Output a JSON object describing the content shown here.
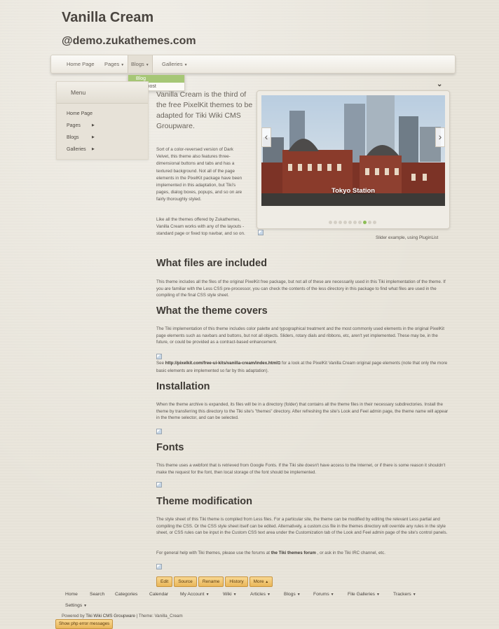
{
  "header": {
    "site_title": "Vanilla Cream",
    "site_subtitle": "@demo.zukathemes.com"
  },
  "navbar": {
    "items": [
      {
        "label": "Home Page"
      },
      {
        "label": "Pages"
      },
      {
        "label": "Blogs"
      },
      {
        "label": "Galleries"
      }
    ],
    "dropdown": [
      "Blog",
      "First post"
    ]
  },
  "sidebar": {
    "title": "Menu",
    "items": [
      "Home Page",
      "Pages",
      "Blogs",
      "Galleries"
    ]
  },
  "intro": {
    "lead": "Vanilla Cream is the third of the free PixelKit themes to be adapted for Tiki Wiki CMS Groupware.",
    "p1": "Sort of a color-reversed version of Dark Velvet, this theme also features three-dimensional buttons and tabs and has a textured background. Not all of the page elements in the PixelKit package have been implemented in this adaptation, but Tiki's pages, dialog boxes, popups, and so on are fairly thoroughly styled.",
    "p2": "Like all the themes offered by Zukathemes, Vanilla Cream works with any of the layouts - standard page or fixed top navbar, and so on."
  },
  "slider": {
    "caption": "Tokyo Station",
    "note": "Slider example, using PluginList",
    "dot_count": 10,
    "active_dot": 8,
    "colors": {
      "sky": "#9bb6cf",
      "brick": "#8a3b2b",
      "active_dot": "#8cbd55"
    }
  },
  "sections": [
    {
      "heading": "What files are included",
      "text": "This theme includes all the files of the original PixelKit free package, but not all of these are necessarily used in this Tiki implementation of the theme. If you are familiar with the Less CSS pre-processor, you can check the contents of the less directory in this package to find what files are used in the compiling of the final CSS style sheet."
    },
    {
      "heading": "What the theme covers",
      "text": "The Tiki implementation of this theme includes color palette and typographical treatment and the most commonly used elements in the original PixelKit page elements such as navbars and buttons, but not all objects. Sliders, rotary dials and ribbons, etc, aren't yet implemented. These may be, in the future, or could be provided as a contract-based enhancement.",
      "see_prefix": "See ",
      "see_link": "http://pixelkit.com/free-ui-kits/vanilla-cream/index.html",
      "see_suffix": " for a look at the PixelKit Vanilla Cream original page elements (note that only the more basic elements are implemented so far by this adaptation)."
    },
    {
      "heading": "Installation",
      "text": "When the theme archive is expanded, its files will be in a directory (folder) that contains all the theme files in their necessary subdirectories. Install the theme by transferring this directory to the Tiki site's \"themes\" directory. After refreshing the site's Look and Feel admin page, the theme name will appear in the theme selector, and can be selected."
    },
    {
      "heading": "Fonts",
      "text": "This theme uses a webfont that is retrieved from Google Fonts. If the Tiki site doesn't have access to the Internet, or if there is some reason it shouldn't make the request for the font, then local storage of the font should be implemented."
    },
    {
      "heading": "Theme modification",
      "text": "The style sheet of this Tiki theme is compiled from Less files. For a particular site, the theme can be modified by editing the relevant Less partial and compiling the CSS. Or the CSS style sheet itself can be edited. Alternatively, a custom.css file in the themes directory will override any rules in the style sheet, or CSS rules can be input in the Custom CSS text area under the Customization tab of the Look and Feel admin page of the site's control panels.",
      "help_prefix": "For general help with Tiki themes, please use the forums at ",
      "help_link": "the Tiki themes forum",
      "help_suffix": " , or ask in the Tiki IRC channel, etc."
    }
  ],
  "buttons": [
    "Edit",
    "Source",
    "Rename",
    "History",
    "More"
  ],
  "footer_nav": [
    "Home",
    "Search",
    "Categories",
    "Calendar",
    "My Account",
    "Wiki",
    "Articles",
    "Blogs",
    "Forums",
    "File Galleries",
    "Trackers",
    "Settings"
  ],
  "footer": {
    "powered_prefix": "Powered by ",
    "powered_link": "Tiki Wiki CMS Groupware",
    "powered_suffix": " | Theme: Vanilla_Cream",
    "error_button": "Show php error messages"
  }
}
